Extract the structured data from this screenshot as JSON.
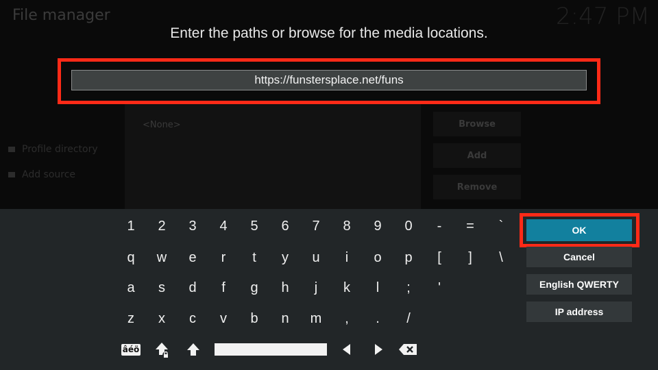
{
  "background": {
    "title": "File manager",
    "clock": "2:47 PM",
    "sidebar_items": [
      "Profile directory",
      "Add source"
    ],
    "list_placeholder": "<None>",
    "buttons": [
      "Browse",
      "Add",
      "Remove"
    ]
  },
  "dialog": {
    "title": "Enter the paths or browse for the media locations.",
    "input_value": "https://funstersplace.net/funs"
  },
  "keyboard": {
    "rows": [
      [
        "1",
        "2",
        "3",
        "4",
        "5",
        "6",
        "7",
        "8",
        "9",
        "0",
        "-",
        "=",
        "`"
      ],
      [
        "q",
        "w",
        "e",
        "r",
        "t",
        "y",
        "u",
        "i",
        "o",
        "p",
        "[",
        "]",
        "\\"
      ],
      [
        "a",
        "s",
        "d",
        "f",
        "g",
        "h",
        "j",
        "k",
        "l",
        ";",
        "'"
      ],
      [
        "z",
        "x",
        "c",
        "v",
        "b",
        "n",
        "m",
        ",",
        ".",
        "/"
      ]
    ],
    "side_buttons": {
      "ok": "OK",
      "cancel": "Cancel",
      "layout": "English QWERTY",
      "ip": "IP address"
    },
    "accent_label": "âéö",
    "highlight_color": "#ff2a17",
    "ok_color": "#12809e"
  }
}
